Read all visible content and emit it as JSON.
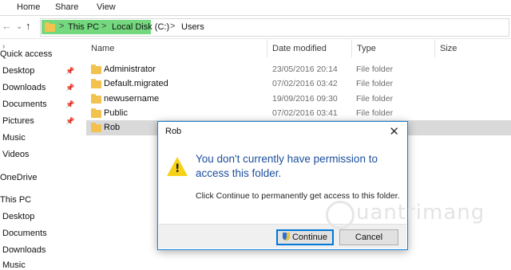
{
  "ribbon": {
    "tabs": [
      "Home",
      "Share",
      "View"
    ]
  },
  "address": {
    "crumbs": [
      "This PC",
      "Local Disk (C:)",
      "Users"
    ],
    "separator": ">"
  },
  "nav": {
    "back": "←",
    "forward": "→",
    "up": "↑",
    "down": "⌄"
  },
  "sidebar": {
    "items": [
      "Quick access",
      "Desktop",
      "Downloads",
      "Documents",
      "Pictures",
      "Music",
      "Videos",
      "OneDrive",
      "This PC",
      "Desktop",
      "Documents",
      "Downloads",
      "Music"
    ]
  },
  "columns": {
    "name": "Name",
    "date": "Date modified",
    "type": "Type",
    "size": "Size"
  },
  "files": [
    {
      "name": "Administrator",
      "date": "23/05/2016 20:14",
      "type": "File folder"
    },
    {
      "name": "Default.migrated",
      "date": "07/02/2016 03:42",
      "type": "File folder"
    },
    {
      "name": "newusername",
      "date": "19/09/2016 09:30",
      "type": "File folder"
    },
    {
      "name": "Public",
      "date": "07/02/2016 03:41",
      "type": "File folder"
    },
    {
      "name": "Rob",
      "date": "",
      "type": ""
    }
  ],
  "dialog": {
    "title": "Rob",
    "close": "✕",
    "warning_icon": "!",
    "main_text": "You don't currently have permission to access this folder.",
    "sub_text": "Click Continue to permanently get access to this folder.",
    "continue_label": "Continue",
    "cancel_label": "Cancel"
  },
  "watermark": {
    "text": "uantrimang"
  },
  "colors": {
    "address_highlight": "#74d97e",
    "dialog_heading": "#1c4f9e",
    "folder": "#f2c14e",
    "accent": "#0078d7"
  }
}
